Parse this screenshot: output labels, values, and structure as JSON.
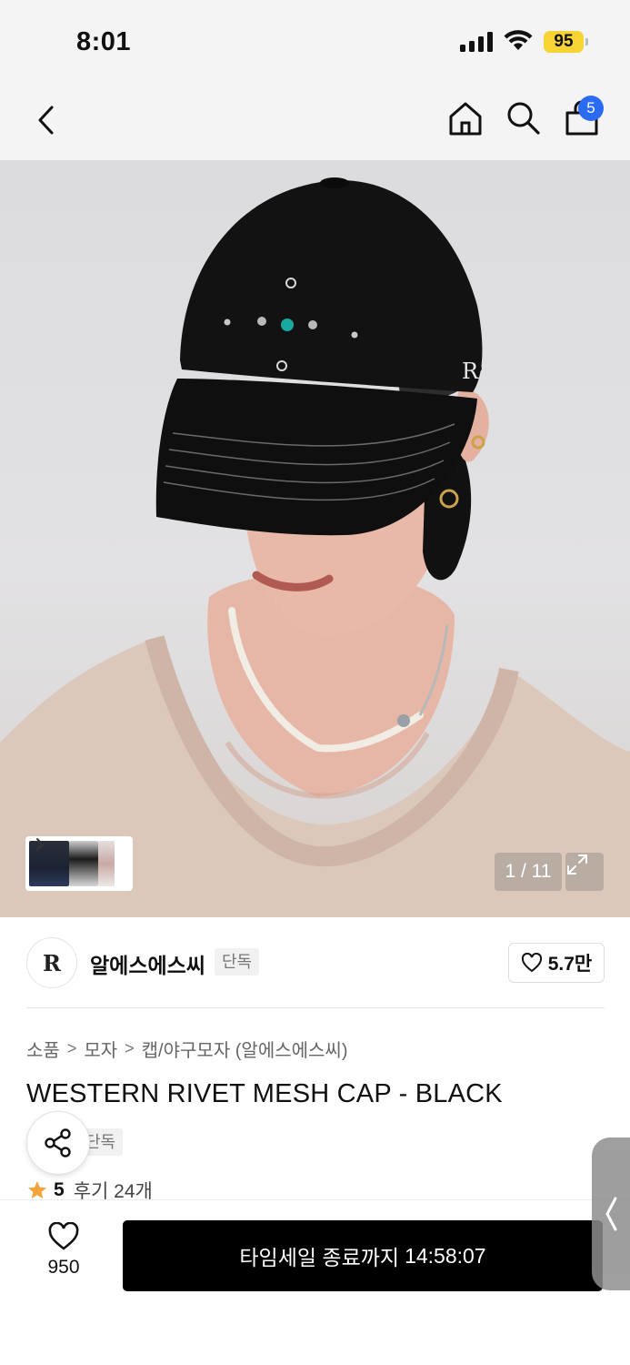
{
  "status_bar": {
    "time": "8:01",
    "battery": "95"
  },
  "nav": {
    "cart_count": "5"
  },
  "gallery": {
    "counter": "1 / 11"
  },
  "brand": {
    "logo_text": "R",
    "name": "알에스에스씨",
    "tag": "단독",
    "likes": "5.7만"
  },
  "breadcrumb": [
    "소품",
    "모자",
    "캡/야구모자 (알에스에스씨)"
  ],
  "product": {
    "title": "WESTERN RIVET MESH CAP - BLACK",
    "exclusive_tag": "단독",
    "rating": "5",
    "review_label": "후기 24개"
  },
  "bottom": {
    "wish_count": "950",
    "cta_label": "타임세일 종료까지",
    "cta_time": "14:58:07"
  },
  "icons": [
    "back-icon",
    "home-icon",
    "search-icon",
    "cart-icon",
    "expand-icon",
    "heart-icon",
    "share-icon",
    "star-icon",
    "chevron-right-icon"
  ],
  "colors": {
    "cart_badge": "#2a6bf2",
    "cta_background": "#000000",
    "star": "#f2a33a",
    "battery": "#f7d333"
  }
}
